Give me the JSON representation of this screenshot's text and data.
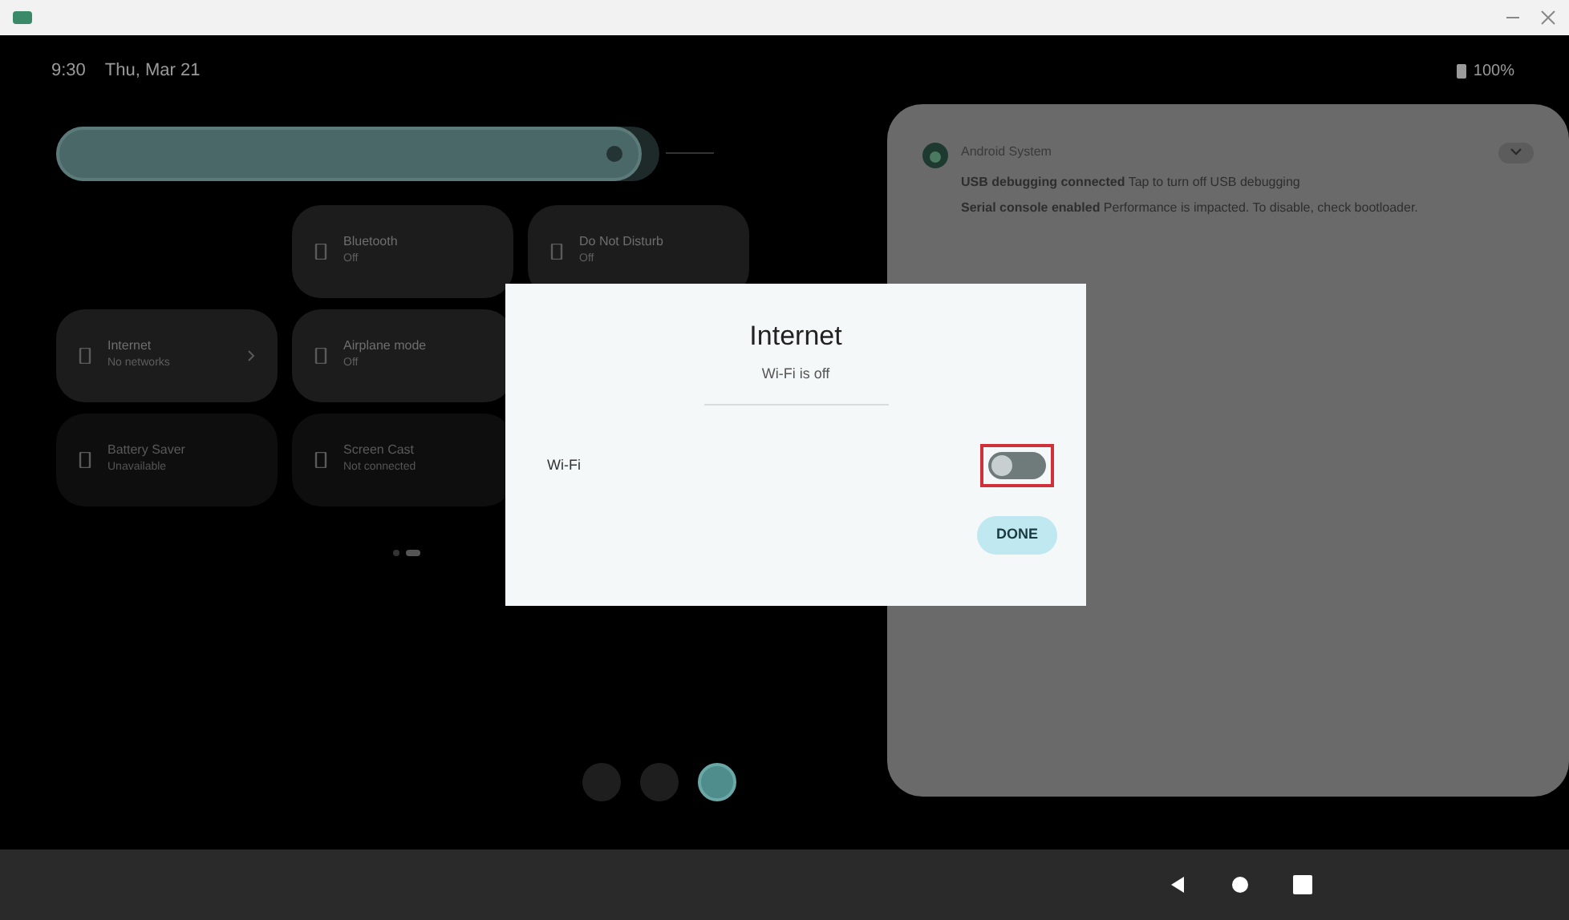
{
  "status_bar": {
    "time": "9:30",
    "date": "Thu, Mar 21",
    "battery": "100%"
  },
  "brightness": {
    "level": 0.97
  },
  "tiles": [
    {
      "title": "Bluetooth",
      "subtitle": "Off",
      "on": false
    },
    {
      "title": "Do Not Disturb",
      "subtitle": "Off",
      "on": false
    },
    {
      "title": "Internet",
      "subtitle": "No networks",
      "on": false,
      "chevron": true
    },
    {
      "title": "Airplane mode",
      "subtitle": "Off",
      "on": false
    },
    {
      "title": "Battery Saver",
      "subtitle": "Unavailable",
      "on": false,
      "dim": true
    },
    {
      "title": "Screen Cast",
      "subtitle": "Not connected",
      "on": false,
      "dim": true
    }
  ],
  "pages": [
    {
      "selected": false
    },
    {
      "selected": true
    }
  ],
  "notification": {
    "app": "Android System",
    "lines": [
      "**USB debugging connected** Tap to turn off USB debugging",
      "**Serial console enabled** Performance is impacted. To disable, check bootloader."
    ],
    "expanded": false
  },
  "dialog": {
    "title": "Internet",
    "subtitle": "Wi-Fi is off",
    "wifi_label": "Wi-Fi",
    "wifi_on": false,
    "highlighted": true,
    "button": "DONE"
  },
  "bottom_buttons": [
    {
      "selected": false
    },
    {
      "selected": false
    },
    {
      "selected": true
    }
  ]
}
